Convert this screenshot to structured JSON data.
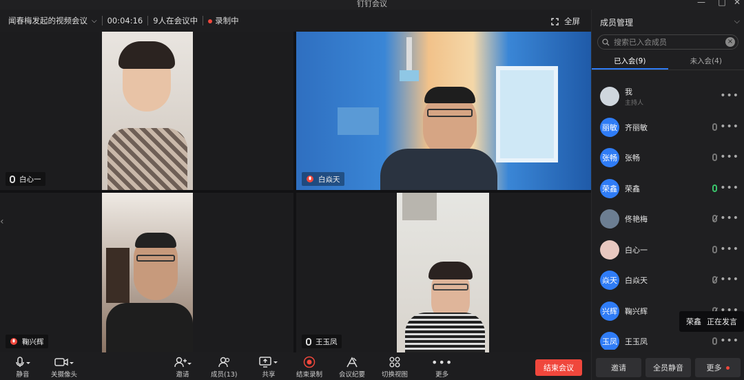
{
  "window": {
    "title": "钉钉会议",
    "minimize": "—",
    "maximize": "□",
    "close": "✕"
  },
  "meeting": {
    "title": "闻春梅发起的视频会议",
    "duration": "00:04:16",
    "attendance": "9人在会议中",
    "recording": "录制中",
    "fullscreen": "全屏"
  },
  "tiles": [
    {
      "name": "白心一",
      "mic": "active"
    },
    {
      "name": "白焱天",
      "mic": "speaking"
    },
    {
      "name": "鞠兴辉",
      "mic": "speaking"
    },
    {
      "name": "王玉凤",
      "mic": "active"
    }
  ],
  "sidebar": {
    "title": "成员管理",
    "search_placeholder": "搜索已入会成员",
    "tabs": [
      "已入会(9)",
      "未入会(4)"
    ],
    "members": [
      {
        "avatar": "",
        "name": "我",
        "role": "主持人",
        "mic": "none"
      },
      {
        "avatar": "丽敏",
        "name": "齐丽敏",
        "role": "",
        "mic": "on"
      },
      {
        "avatar": "张畅",
        "name": "张畅",
        "role": "",
        "mic": "on"
      },
      {
        "avatar": "荣鑫",
        "name": "荣鑫",
        "role": "",
        "mic": "green"
      },
      {
        "avatar": "",
        "name": "佟艳梅",
        "role": "",
        "mic": "muted"
      },
      {
        "avatar": "",
        "name": "白心一",
        "role": "",
        "mic": "on"
      },
      {
        "avatar": "焱天",
        "name": "白焱天",
        "role": "",
        "mic": "muted"
      },
      {
        "avatar": "兴辉",
        "name": "鞠兴辉",
        "role": "",
        "mic": "muted"
      },
      {
        "avatar": "玉凤",
        "name": "王玉凤",
        "role": "",
        "mic": "on"
      }
    ],
    "footer": {
      "invite": "邀请",
      "mute_all": "全员静音",
      "more": "更多"
    }
  },
  "speaking_tooltip": {
    "name": "荣鑫",
    "status": "正在发言"
  },
  "toolbar": {
    "mute": "静音",
    "camera": "关摄像头",
    "invite": "邀请",
    "members": "成员(13)",
    "share": "共享",
    "end_record": "结束录制",
    "minutes": "会议纪要",
    "switch_view": "切换视图",
    "more": "更多",
    "end_meeting": "结束会议"
  },
  "colors": {
    "accent": "#2f7cf6",
    "danger": "#f0473c",
    "speaking": "#39c46b"
  }
}
